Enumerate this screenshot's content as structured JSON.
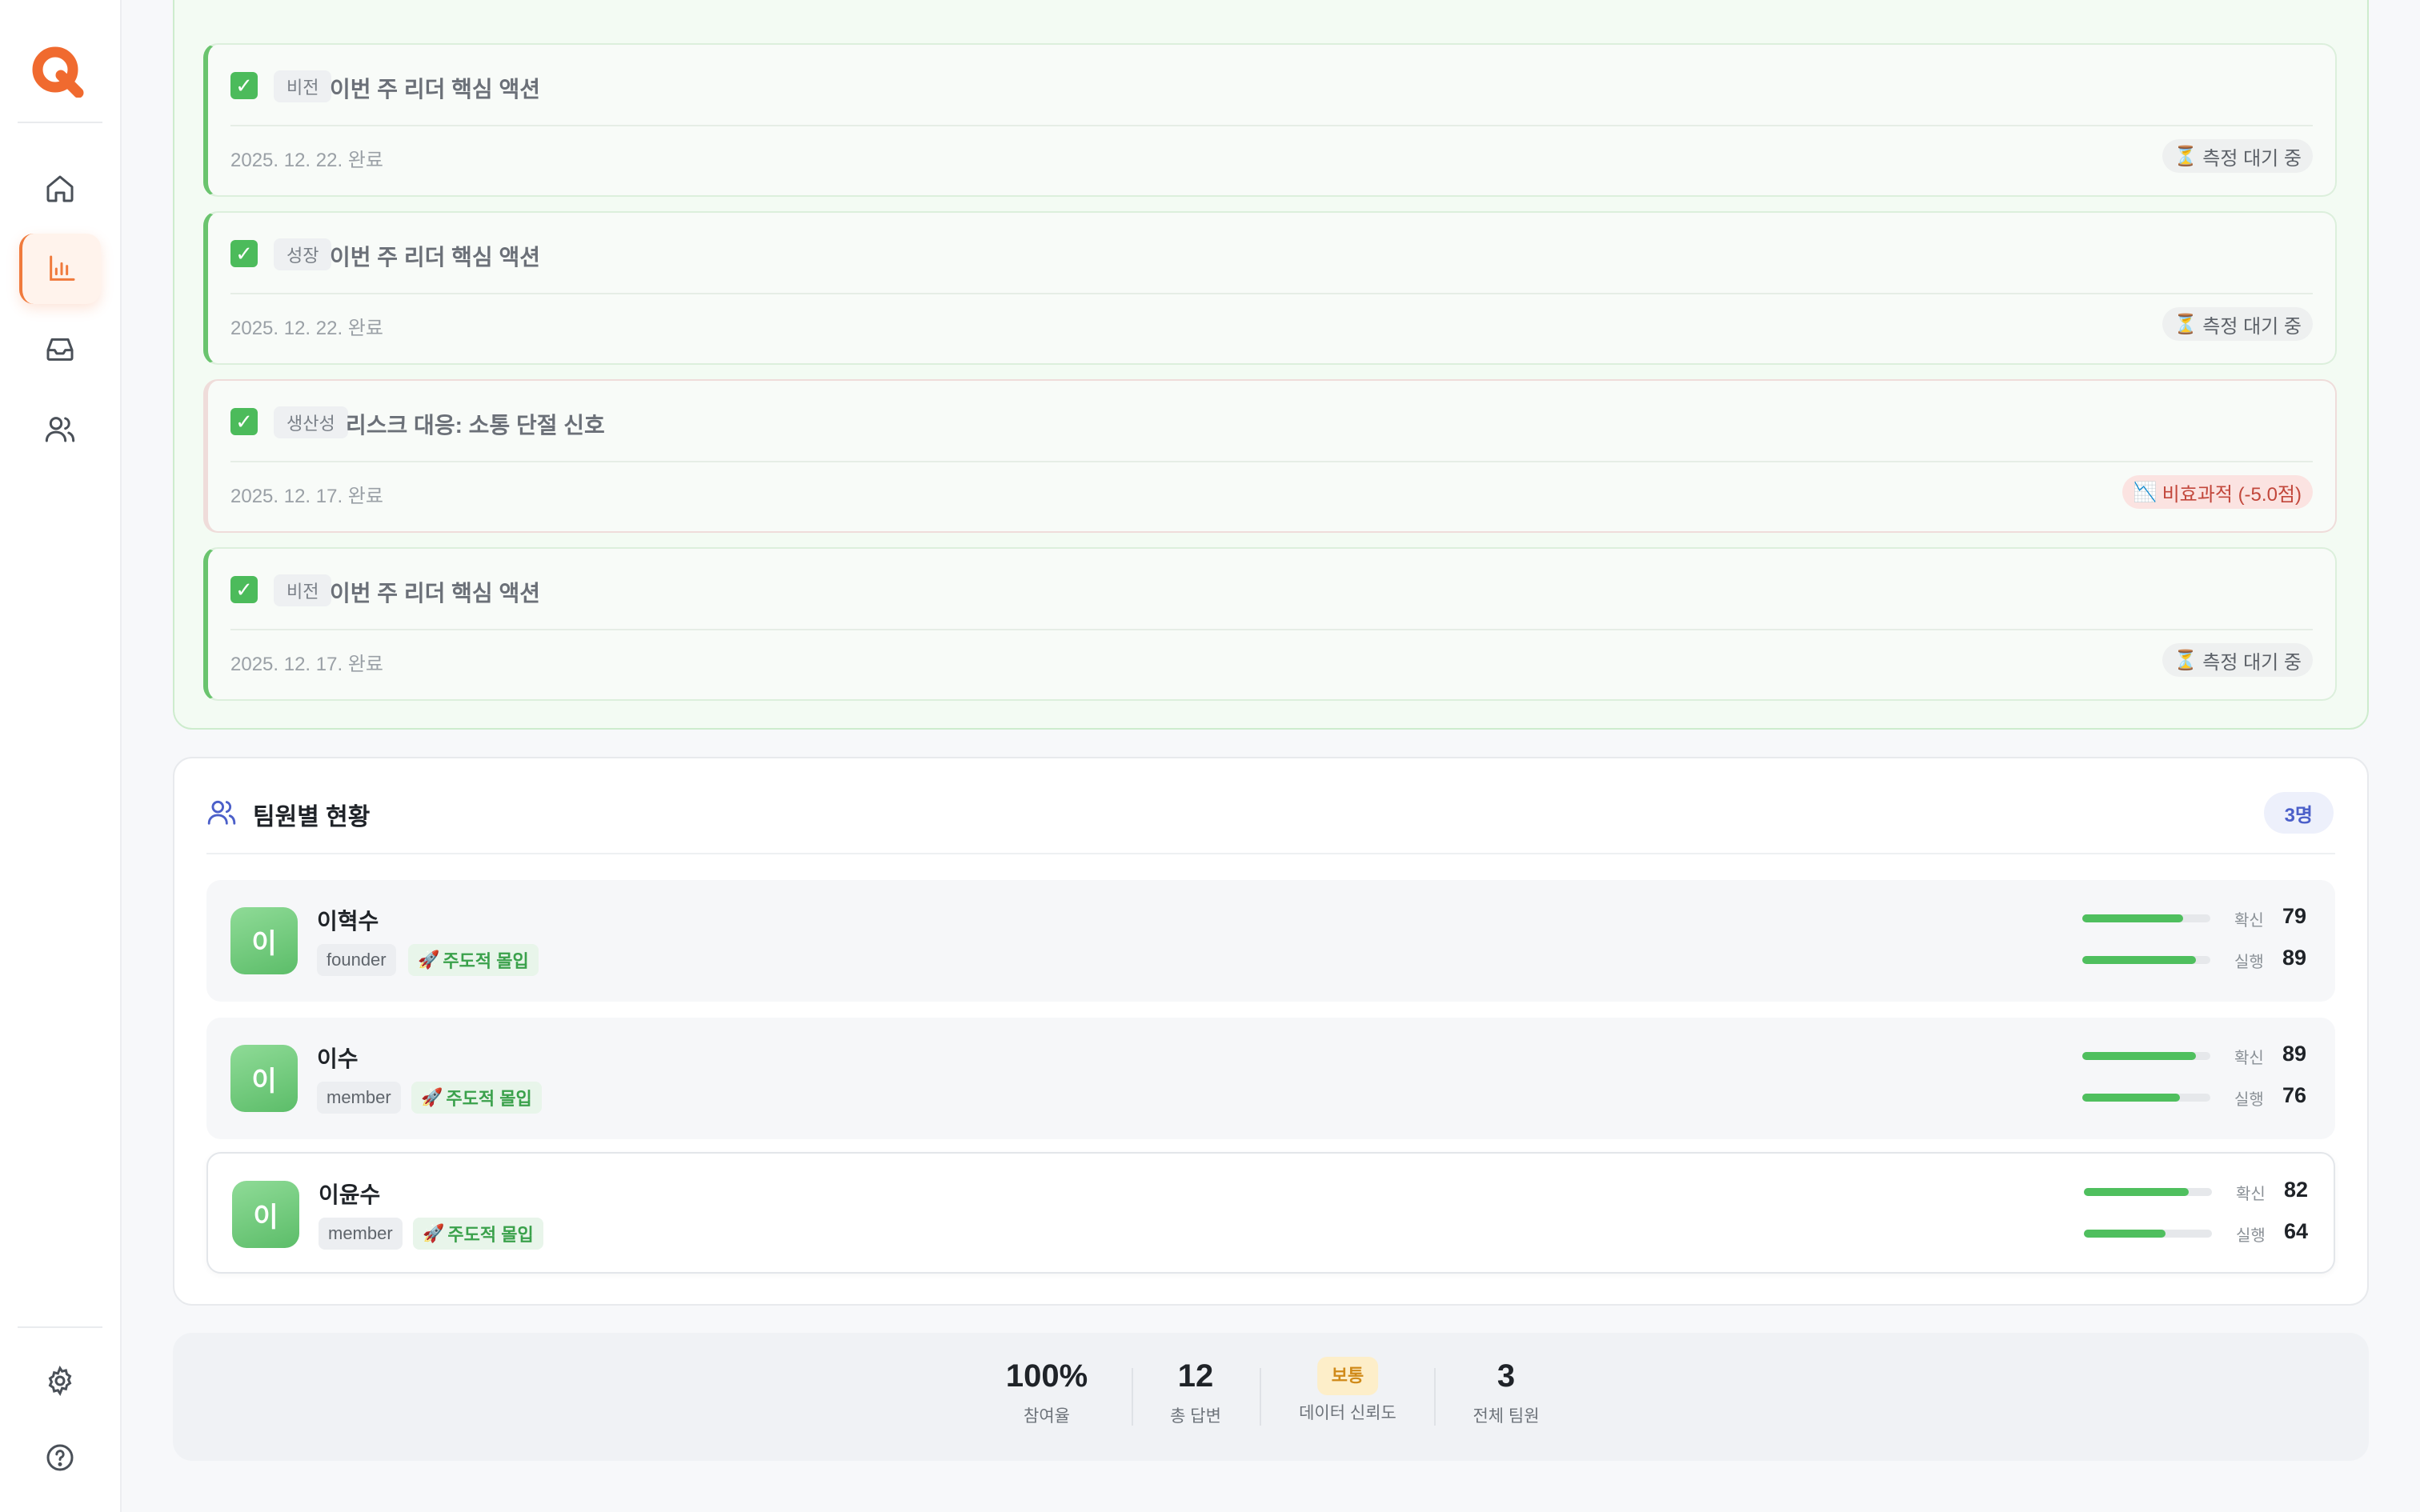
{
  "sidebar": {
    "items": [
      {
        "name": "home",
        "active": false
      },
      {
        "name": "analytics",
        "active": true
      },
      {
        "name": "inbox",
        "active": false
      },
      {
        "name": "team",
        "active": false
      }
    ],
    "bottom": [
      "settings",
      "help"
    ],
    "accent": "#f07a3c"
  },
  "actions": [
    {
      "category": "비전",
      "title": "이번 주 리더 핵심 액션",
      "date": "2025. 12. 22. 완료",
      "status": "측정 대기 중",
      "status_icon": "hourglass-icon",
      "tone": "pending"
    },
    {
      "category": "성장",
      "title": "이번 주 리더 핵심 액션",
      "date": "2025. 12. 22. 완료",
      "status": "측정 대기 중",
      "status_icon": "hourglass-icon",
      "tone": "pending"
    },
    {
      "category": "생산성",
      "title": "리스크 대응: 소통 단절 신호",
      "date": "2025. 12. 17. 완료",
      "status": "비효과적 (-5.0점)",
      "status_icon": "chart-down-icon",
      "tone": "bad"
    },
    {
      "category": "비전",
      "title": "이번 주 리더 핵심 액션",
      "date": "2025. 12. 17. 완료",
      "status": "측정 대기 중",
      "status_icon": "hourglass-icon",
      "tone": "pending"
    }
  ],
  "team": {
    "title": "팀원별 현황",
    "count": "3명",
    "metric_labels": {
      "confidence": "확신",
      "execution": "실행"
    },
    "members": [
      {
        "avatar": "이",
        "name": "이혁수",
        "role": "founder",
        "tag": "주도적 몰입",
        "confidence": 79,
        "execution": 89
      },
      {
        "avatar": "이",
        "name": "이수",
        "role": "member",
        "tag": "주도적 몰입",
        "confidence": 89,
        "execution": 76
      },
      {
        "avatar": "이",
        "name": "이윤수",
        "role": "member",
        "tag": "주도적 몰입",
        "confidence": 82,
        "execution": 64
      }
    ]
  },
  "stats": {
    "participation": {
      "value": "100%",
      "label": "참여율"
    },
    "answers": {
      "value": "12",
      "label": "총 답변"
    },
    "reliability": {
      "value": "보통",
      "label": "데이터 신뢰도"
    },
    "members": {
      "value": "3",
      "label": "전체 팀원"
    }
  }
}
